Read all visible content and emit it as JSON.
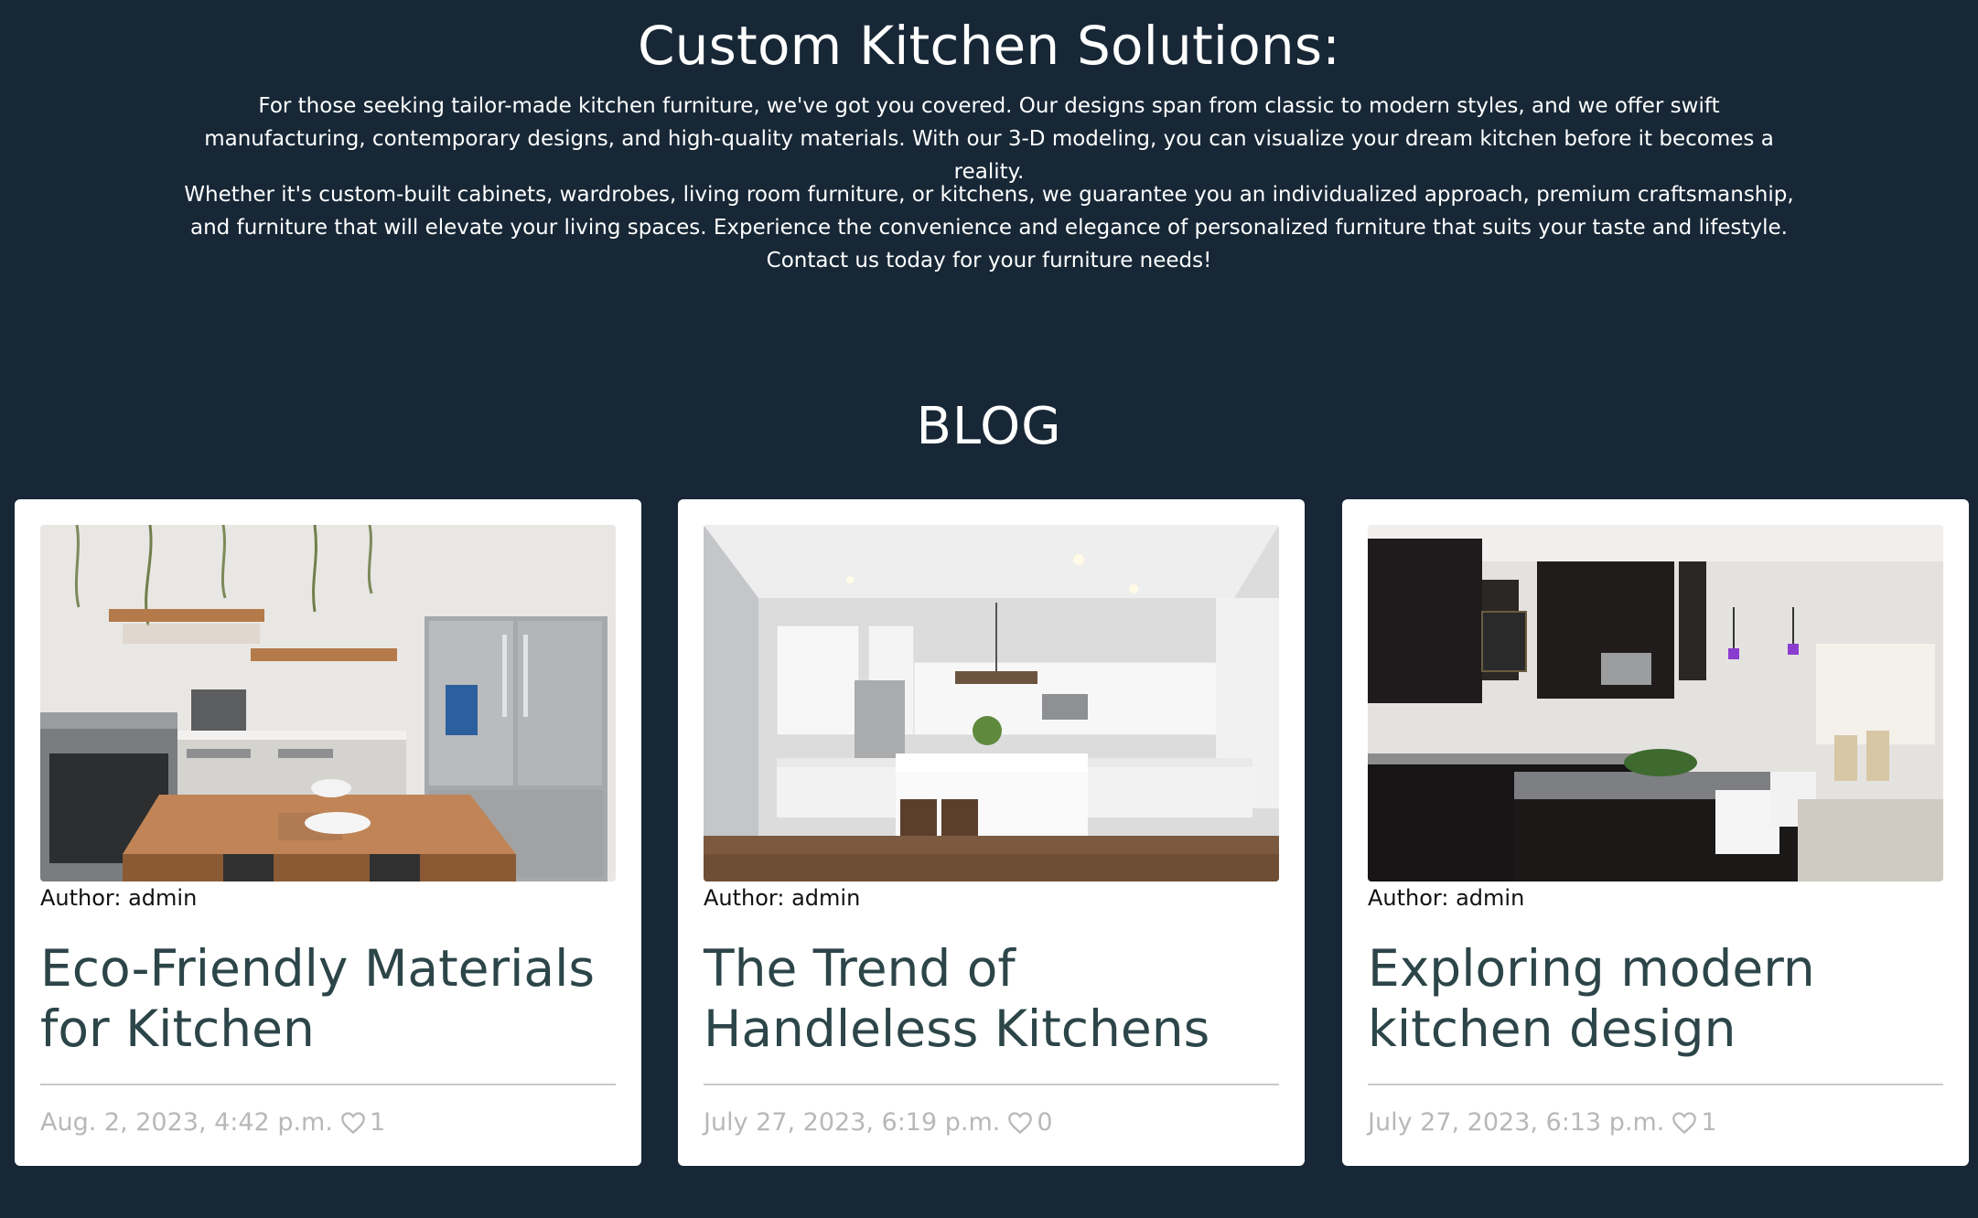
{
  "intro": {
    "title": "Custom Kitchen Solutions:",
    "paragraph1": "For those seeking tailor-made kitchen furniture, we've got you covered. Our designs span from classic to modern styles, and we offer swift manufacturing, contemporary designs, and high-quality materials. With our 3-D modeling, you can visualize your dream kitchen before it becomes a reality.",
    "paragraph2": "Whether it's custom-built cabinets, wardrobes, living room furniture, or kitchens, we guarantee you an individualized approach, premium craftsmanship, and furniture that will elevate your living spaces. Experience the convenience and elegance of personalized furniture that suits your taste and lifestyle. Contact us today for your furniture needs!"
  },
  "blog": {
    "title": "BLOG",
    "posts": [
      {
        "author": "Author: admin",
        "title": "Eco-Friendly Materials for Kitchen",
        "date": "Aug. 2, 2023, 4:42 p.m.",
        "likes": "1",
        "image": "kitchen-photo-stainless-fridge-wooden-island"
      },
      {
        "author": "Author: admin",
        "title": "The Trend of Handleless Kitchens",
        "date": "July 27, 2023, 6:19 p.m.",
        "likes": "0",
        "image": "kitchen-photo-white-cabinets-island"
      },
      {
        "author": "Author: admin",
        "title": "Exploring modern kitchen design",
        "date": "July 27, 2023, 6:13 p.m.",
        "likes": "1",
        "image": "kitchen-photo-black-cabinets-grey-island"
      }
    ]
  },
  "colors": {
    "background": "#172736",
    "card_title": "#2c4548",
    "meta_text": "#b8b8b8"
  }
}
